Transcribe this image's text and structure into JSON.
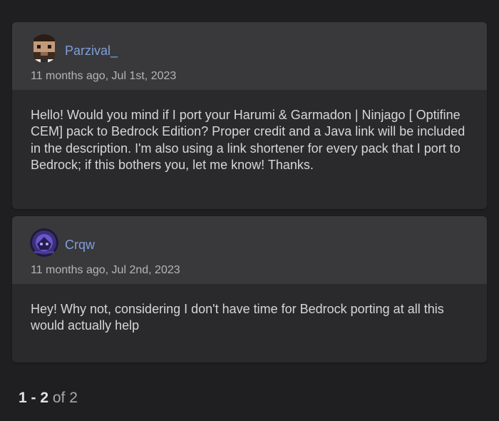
{
  "comments": [
    {
      "author": "Parzival_",
      "avatar": "pixel-face-avatar",
      "timestamp": "11 months ago, Jul 1st, 2023",
      "body": "Hello! Would you mind if I port your Harumi & Garmadon | Ninjago [ Optifine CEM] pack to Bedrock Edition? Proper credit and a Java link will be included in the description. I'm also using a link shortener for every pack that I port to Bedrock; if this bothers you, let me know! Thanks."
    },
    {
      "author": "Crqw",
      "avatar": "purple-emblem-avatar",
      "timestamp": "11 months ago, Jul 2nd, 2023",
      "body": "Hey! Why not, considering I don't have time for Bedrock porting at all this would actually help"
    }
  ],
  "pagination": {
    "range": "1 - 2",
    "of_label": "of 2"
  },
  "colors": {
    "background": "#1f1f21",
    "card": "#2a2a2d",
    "card_header": "#39393c",
    "author_link": "#7e9fd8",
    "body_text": "#d6d6d8"
  }
}
